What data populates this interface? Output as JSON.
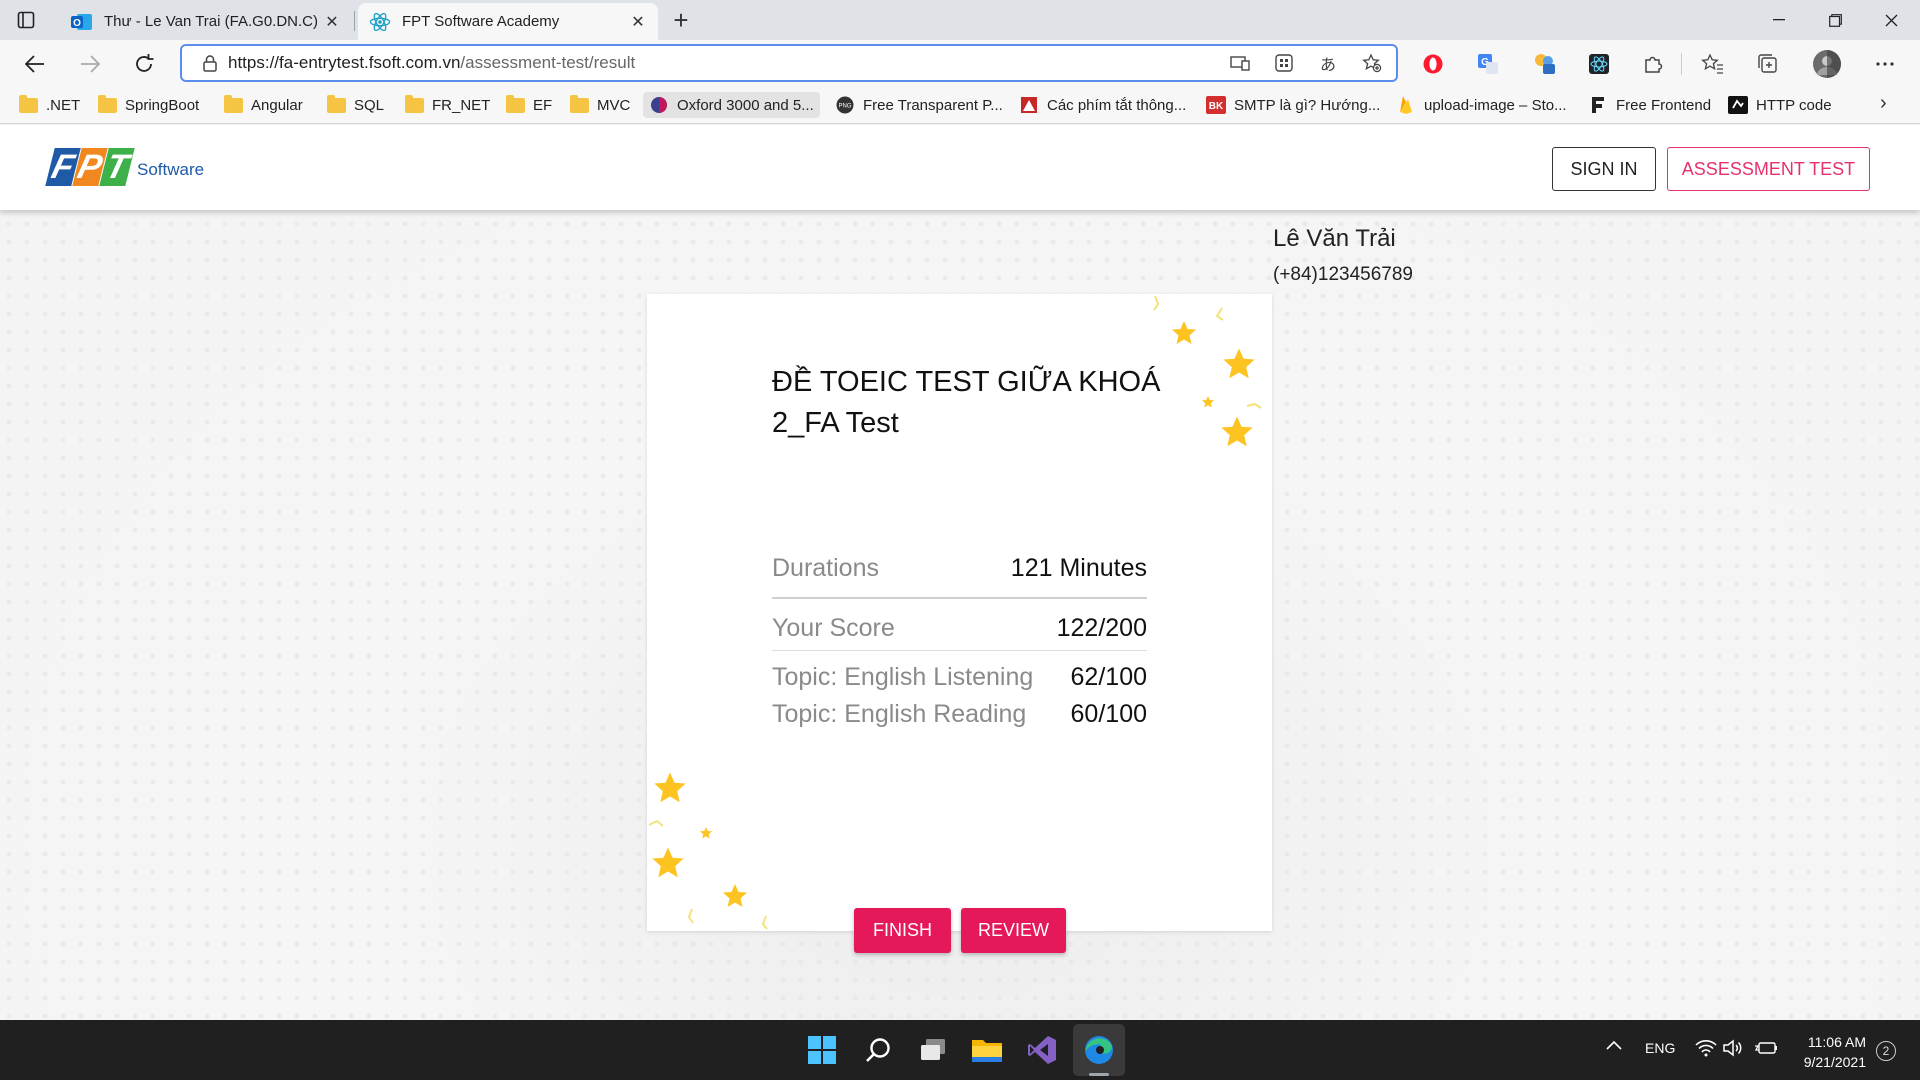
{
  "browser": {
    "tabs": [
      {
        "title": "Thư - Le Van Trai (FA.G0.DN.C) - Outlook",
        "icon": "outlook-icon",
        "active": false
      },
      {
        "title": "FPT Software Academy",
        "icon": "react-icon",
        "active": true
      }
    ],
    "url_host": "https://fa-entrytest.fsoft.com.vn",
    "url_path": "/assessment-test/result",
    "bookmarks": [
      {
        "label": ".NET",
        "icon": "folder-icon"
      },
      {
        "label": "SpringBoot",
        "icon": "folder-icon"
      },
      {
        "label": "Angular",
        "icon": "folder-icon"
      },
      {
        "label": "SQL",
        "icon": "folder-icon"
      },
      {
        "label": "FR_NET",
        "icon": "folder-icon"
      },
      {
        "label": "EF",
        "icon": "folder-icon"
      },
      {
        "label": "MVC",
        "icon": "folder-icon"
      },
      {
        "label": "Oxford 3000 and 5...",
        "icon": "oxford-icon"
      },
      {
        "label": "Free Transparent P...",
        "icon": "png-icon"
      },
      {
        "label": "Các phím tắt thông...",
        "icon": "site-icon"
      },
      {
        "label": "SMTP là gì? Hướng...",
        "icon": "bk-icon"
      },
      {
        "label": "upload-image – Sto...",
        "icon": "firebase-icon"
      },
      {
        "label": "Free Frontend",
        "icon": "ff-icon"
      },
      {
        "label": "HTTP code",
        "icon": "http-icon"
      }
    ]
  },
  "site": {
    "brand_letters": [
      "F",
      "P",
      "T"
    ],
    "brand_sub": "Software",
    "sign_in": "SIGN IN",
    "assessment_test": "ASSESSMENT TEST"
  },
  "user": {
    "name": "Lê Văn Trải",
    "phone": "(+84)123456789"
  },
  "result": {
    "title": "ĐỀ TOEIC TEST GIỮA KHOÁ 2_FA Test",
    "duration_label": "Durations",
    "duration_value": "121 Minutes",
    "score_label": "Your Score",
    "score_value": "122/200",
    "topics": [
      {
        "label": "Topic: English Listening",
        "value": "62/100"
      },
      {
        "label": "Topic: English Reading",
        "value": "60/100"
      }
    ],
    "finish": "FINISH",
    "review": "REVIEW"
  },
  "taskbar": {
    "lang": "ENG",
    "time": "11:06 AM",
    "date": "9/21/2021",
    "notifications": "2"
  },
  "colors": {
    "accent": "#e5185a",
    "star": "#fdc321",
    "fpt_blue": "#1f5aa6",
    "fpt_orange": "#f0871f",
    "fpt_green": "#3db049"
  }
}
